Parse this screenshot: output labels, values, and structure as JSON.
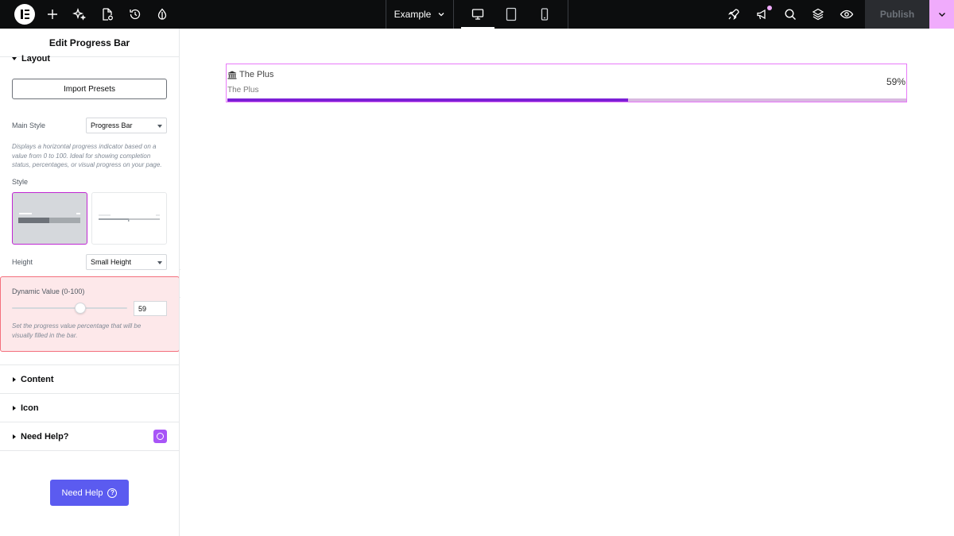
{
  "topbar": {
    "document_title": "Example",
    "publish_label": "Publish",
    "icons": [
      "elementor-logo-icon",
      "plus-icon",
      "sparkle-icon",
      "page-settings-icon",
      "history-icon",
      "theme-style-icon",
      "desktop-icon",
      "tablet-icon",
      "mobile-icon",
      "rocket-icon",
      "megaphone-icon",
      "search-icon",
      "layers-icon",
      "preview-eye-icon",
      "chevron-down-icon"
    ]
  },
  "sidebar": {
    "header_title": "Edit Progress Bar",
    "layout_section": "Layout",
    "import_presets": "Import Presets",
    "main_style_label": "Main Style",
    "main_style_value": "Progress Bar",
    "main_style_desc": "Displays a horizontal progress indicator based on a value from 0 to 100. Ideal for showing completion status, percentages, or visual progress on your page.",
    "style_label": "Style",
    "height_label": "Height",
    "height_value": "Small Height",
    "dynamic_label": "Dynamic Value (0-100)",
    "dynamic_value": "59",
    "dynamic_fraction": 0.59,
    "dynamic_desc": "Set the progress value percentage that will be visually filled in the bar.",
    "sections": {
      "content": "Content",
      "icon": "Icon",
      "need_help": "Need Help?"
    },
    "need_help_button": "Need Help",
    "help_glyph": "?"
  },
  "canvas": {
    "progress": {
      "title": "The Plus",
      "subtitle": "The Plus",
      "percent_label": "59%",
      "value": 0.59,
      "fill_color": "#7c1fd6",
      "track_color": "#d8b8e0",
      "title_icon": "bank-icon"
    }
  },
  "colors": {
    "topbar_bg": "#0c0d0e",
    "accent_pink": "#f0abfc",
    "widget_outline": "#e879f9",
    "help_button": "#5b5bf0",
    "dynamic_highlight": "#fde8ea"
  }
}
